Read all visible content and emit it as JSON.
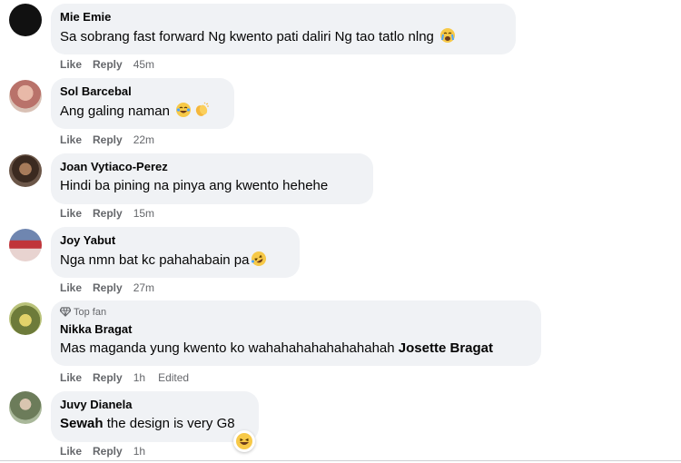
{
  "actions": {
    "like": "Like",
    "reply": "Reply"
  },
  "comments": [
    {
      "name": "Mie Emie",
      "text": "Sa sobrang fast forward Ng kwento pati daliri Ng tao tatlo nlng",
      "emoji": "crying-face",
      "time": "45m"
    },
    {
      "name": "Sol Barcebal",
      "text": "Ang galing naman",
      "emoji": "tears-of-joy-and-clapping-hands",
      "time": "22m"
    },
    {
      "name": "Joan Vytiaco-Perez",
      "text": "Hindi ba pining na pinya ang kwento hehehe",
      "time": "15m"
    },
    {
      "name": "Joy Yabut",
      "text": "Nga nmn bat kc pahahabain pa",
      "emoji": "rolling-on-floor-laughing",
      "time": "27m"
    },
    {
      "badge": "Top fan",
      "name": "Nikka Bragat",
      "text": "Mas maganda yung kwento ko wahahahahahahahahah",
      "mention": "Josette Bragat",
      "time": "1h",
      "edited": "Edited"
    },
    {
      "name": "Juvy Dianela",
      "mention": "Sewah",
      "text": "the design is very G8",
      "reaction": "haha-reaction",
      "time": "1h"
    }
  ]
}
